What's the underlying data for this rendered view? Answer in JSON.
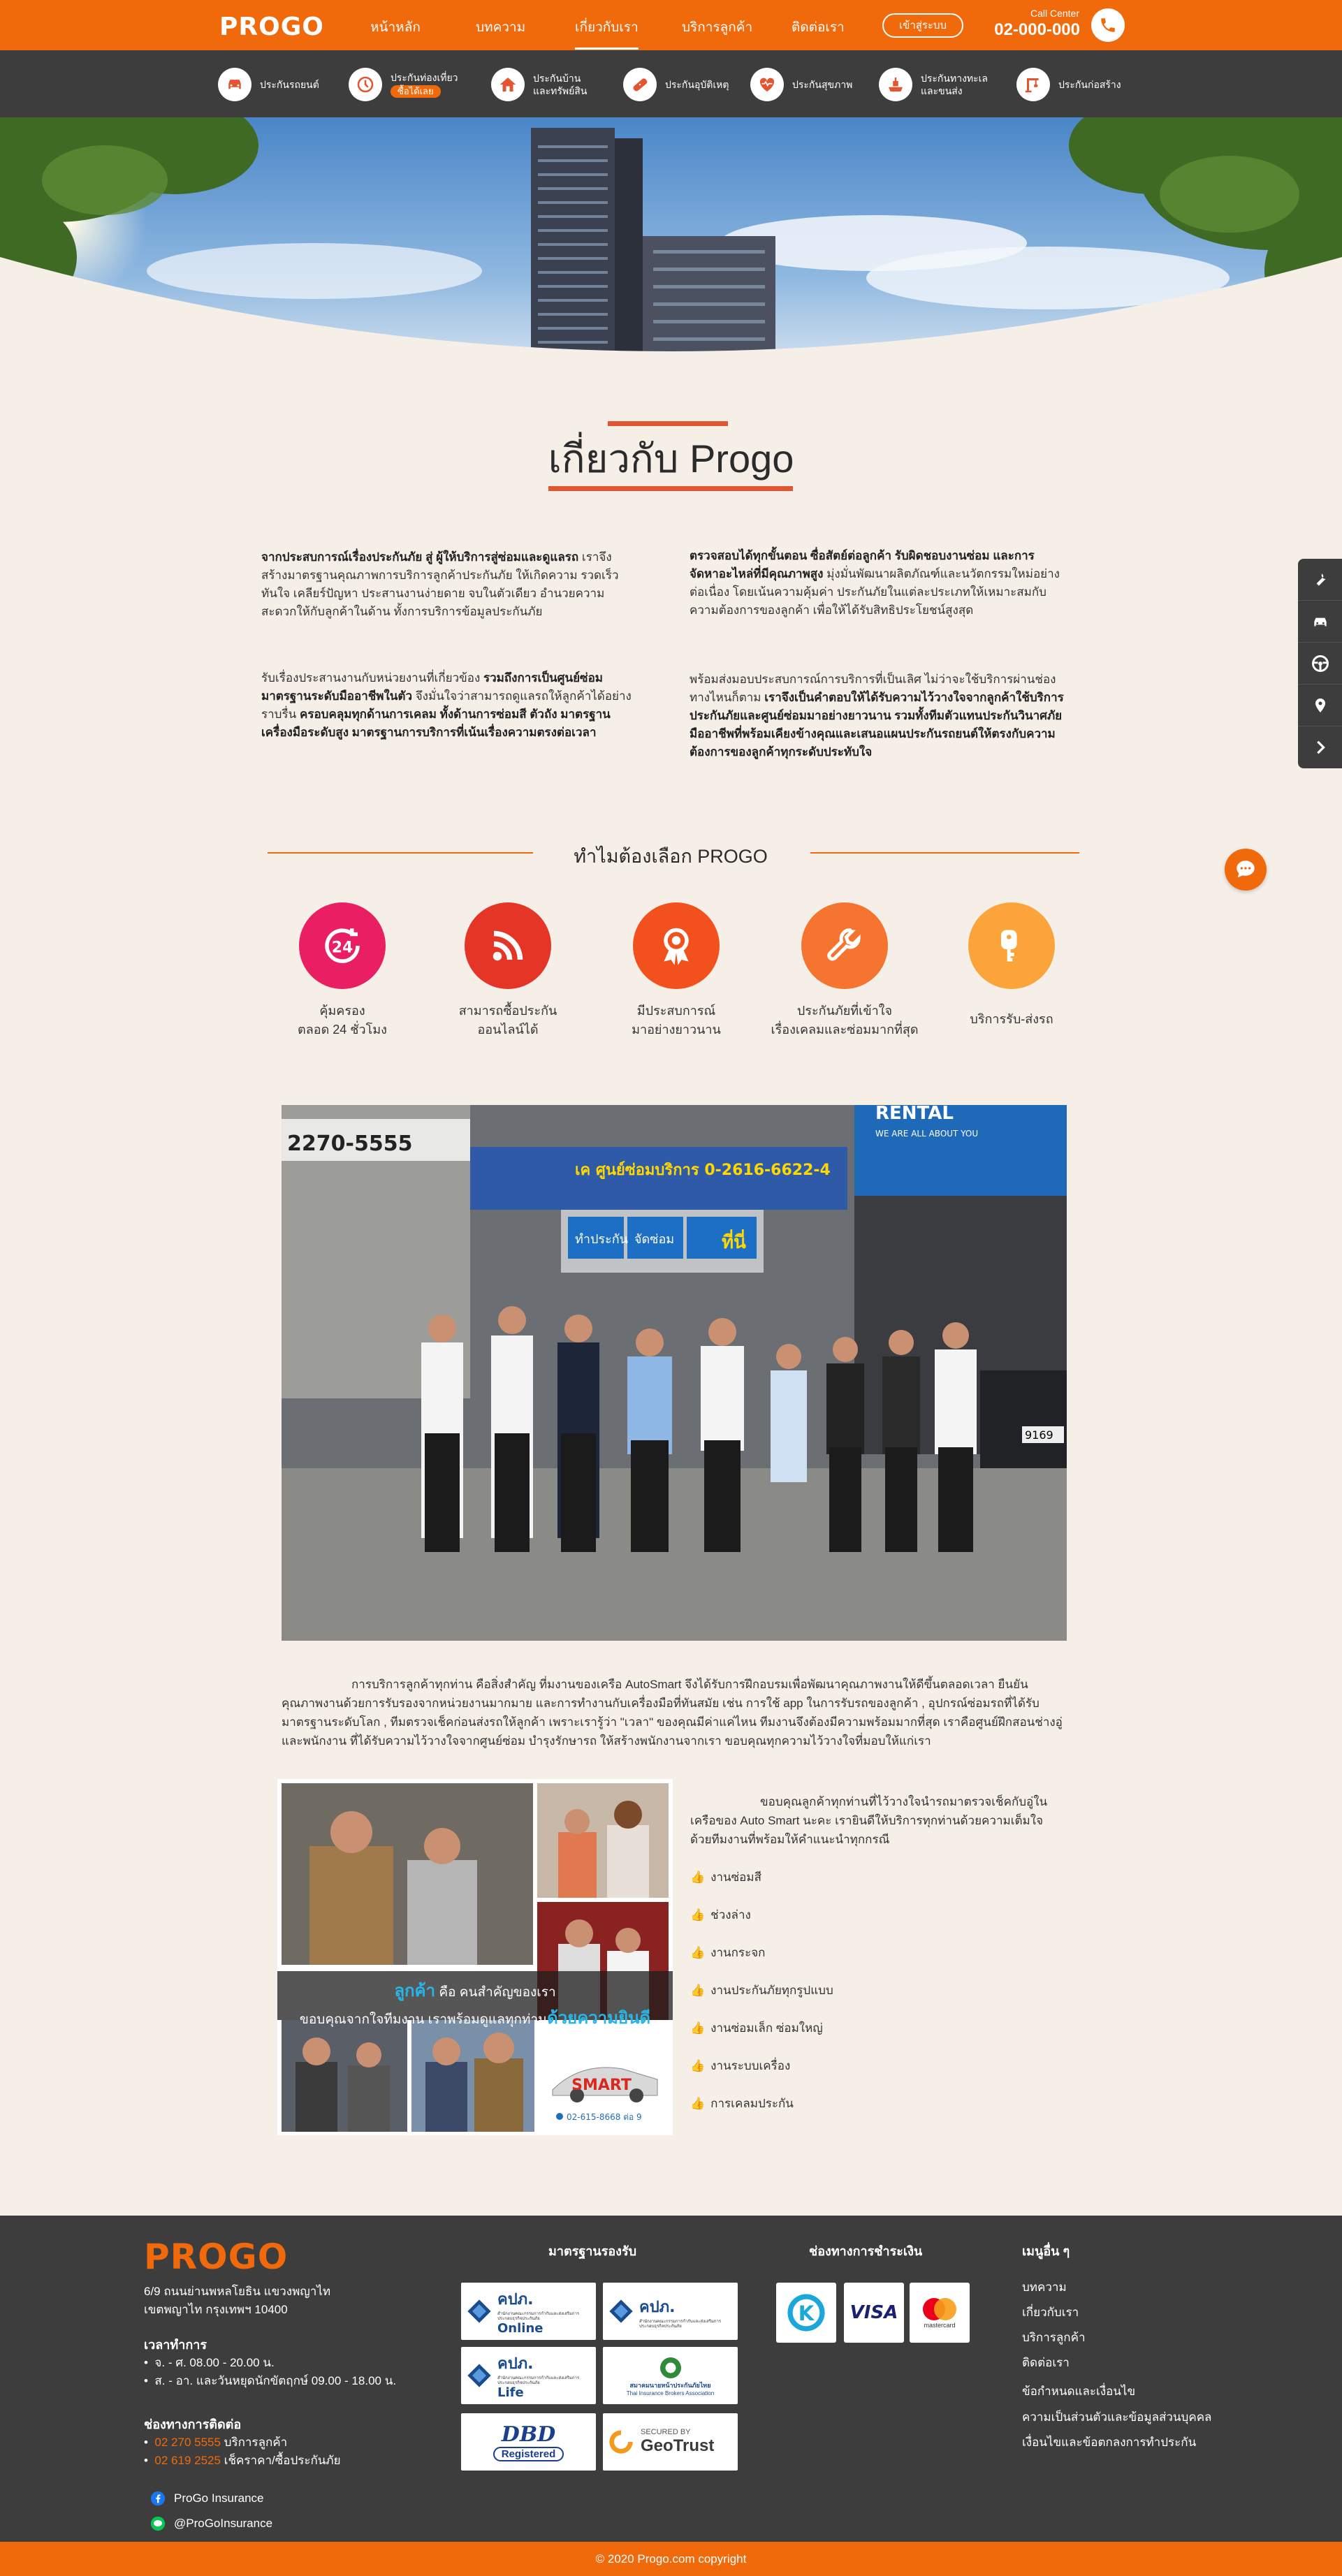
{
  "nav": {
    "logo": "PROGO",
    "items": [
      "หน้าหลัก",
      "บทความ",
      "เกี่ยวกับเรา",
      "บริการลูกค้า",
      "ติดต่อเรา"
    ],
    "login": "เข้าสู่ระบบ",
    "call_label": "Call Center",
    "call_number": "02-000-000"
  },
  "subnav": [
    {
      "label": "ประกันรถยนต์",
      "icon": "car-icon"
    },
    {
      "label": "ประกันท่องเที่ยว",
      "badge": "ซื้อได้เลย",
      "icon": "travel-icon"
    },
    {
      "label": "ประกันบ้าน",
      "label2": "และทรัพย์สิน",
      "icon": "house-icon"
    },
    {
      "label": "ประกันอุบัติเหตุ",
      "icon": "bandage-icon"
    },
    {
      "label": "ประกันสุขภาพ",
      "icon": "heart-pulse-icon"
    },
    {
      "label": "ประกันทางทะเล",
      "label2": "และขนส่ง",
      "icon": "ship-icon"
    },
    {
      "label": "ประกันก่อสร้าง",
      "icon": "crane-icon"
    }
  ],
  "about": {
    "title": "เกี่ยวกับ Progo",
    "p1": {
      "b1": "จากประสบการณ์เรื่องประกันภัย สู่ ผู้ให้บริการสู่ซ่อมและดูแลรถ",
      "t1": " เราจึงสร้างมาตรฐานคุณภาพการบริการลูกค้าประกันภัย ให้เกิดความ รวดเร็ว ทันใจ เคลียร์ปัญหา ประสานงานง่ายดาย จบในตัวเดียว อำนวยความสะดวกให้กับลูกค้าในด้าน ทั้งการบริการข้อมูลประกันภัย"
    },
    "p2": {
      "b1": "ตรวจสอบได้ทุกขั้นตอน ซื่อสัตย์ต่อลูกค้า รับผิดชอบงานซ่อม และการจัดหาอะไหล่ที่มีคุณภาพสูง",
      "t1": " มุ่งมั่นพัฒนาผลิตภัณฑ์และนวัตกรรมใหม่อย่างต่อเนื่อง โดยเน้นความคุ้มค่า ประกันภัยในแต่ละประเภทให้เหมาะสมกับความต้องการของลูกค้า เพื่อให้ได้รับสิทธิประโยชน์สูงสุด"
    },
    "p3": {
      "t1": "รับเรื่องประสานงานกับหน่วยงานที่เกี่ยวข้อง ",
      "b1": "รวมถึงการเป็นศูนย์ซ่อมมาตรฐานระดับมืออาชีพในตัว",
      "t2": " จึงมั่นใจว่าสามารถดูแลรถให้ลูกค้าได้อย่างราบรื่น ",
      "b2": "ครอบคลุมทุกด้านการเคลม ทั้งด้านการซ่อมสี ตัวถัง มาตรฐานเครื่องมือระดับสูง มาตรฐานการบริการที่เน้นเรื่องความตรงต่อเวลา"
    },
    "p4": {
      "t1": "พร้อมส่งมอบประสบการณ์การบริการที่เป็นเลิศ ไม่ว่าจะใช้บริการผ่านช่องทางไหนก็ตาม ",
      "b1": "เราจึงเป็นคำตอบให้ได้รับความไว้วางใจจากลูกค้าใช้บริการประกันภัยและศูนย์ซ่อมมาอย่างยาวนาน รวมทั้งทีมตัวแทนประกันวินาศภัยมืออาชีพที่พร้อมเคียงข้างคุณและเสนอแผนประกันรถยนต์ให้ตรงกับความต้องการของลูกค้าทุกระดับประทับใจ"
    }
  },
  "why": {
    "title": "ทำไมต้องเลือก PROGO",
    "features": [
      {
        "l1": "คุ้มครอง",
        "l2": "ตลอด 24 ชั่วโมง",
        "color": "#e91e63",
        "icon": "clock-24-icon"
      },
      {
        "l1": "สามารถซื้อประกัน",
        "l2": "ออนไลน์ได้",
        "color": "#e53527",
        "icon": "rss-icon"
      },
      {
        "l1": "มีประสบการณ์",
        "l2": "มาอย่างยาวนาน",
        "color": "#f2511d",
        "icon": "award-icon"
      },
      {
        "l1": "ประกันภัยที่เข้าใจ",
        "l2": "เรื่องเคลมและซ่อมมากที่สุด",
        "color": "#f47430",
        "icon": "wrench-icon"
      },
      {
        "l1": "บริการรับ-ส่งรถ",
        "l2": "",
        "color": "#fba43a",
        "icon": "car-key-icon"
      }
    ]
  },
  "photo_signs": {
    "phone": "2270-5555",
    "rental": "RENTAL",
    "rental_sub": "WE ARE ALL ABOUT YOU",
    "banner": "เค ศูนย์ซ่อมบริการ 0-2616-6622-4",
    "s1": "ทำประกัน",
    "s2": "จัดซ่อม",
    "s3": "ที่นี่",
    "plate": "9169"
  },
  "body_text": "การบริการลูกค้าทุกท่าน คือสิ่งสำคัญ ที่มงานของเครือ AutoSmart จึงได้รับการฝึกอบรมเพื่อพัฒนาคุณภาพงานให้ดีขึ้นตลอดเวลา ยืนยันคุณภาพงานด้วยการรับรองจากหน่วยงานมากมาย และการทำงานกับเครื่องมือที่ทันสมัย เช่น การใช้ app ในการรับรถของลูกค้า , อุปกรณ์ซ่อมรถที่ได้รับมาตรฐานระดับโลก , ทีมตรวจเช็คก่อนส่งรถให้ลูกค้า เพราะเรารู้ว่า \"เวลา\" ของคุณมีค่าแค่ไหน ทีมงานจึงต้องมีความพร้อมมากที่สุด  เราคือศูนย์ฝึกสอนช่างอู่และพนักงาน ที่ได้รับความไว้วางใจจากศูนย์ซ่อม บำรุงรักษารถ ให้สร้างพนักงานจากเรา ขอบคุณทุกความไว้วางใจที่มอบให้แก่เรา",
  "collage": {
    "caption_accent1": "ลูกค้า",
    "caption1": " คือ คนสำคัญของเรา",
    "caption2": "ขอบคุณจากใจทีมงาน เราพร้อมดูแลทุกท่าน",
    "caption_accent2": "ด้วยความยินดี",
    "brand": "SMART",
    "phone": "02-615-8668 ต่อ 9"
  },
  "thanks": {
    "text": "ขอบคุณลูกค้าทุกท่านที่ไว้วางใจนำรถมาตรวจเช็คกับอู่ในเครือของ Auto Smart นะคะ เรายินดีให้บริการทุกท่านด้วยความเต็มใจ ด้วยทีมงานที่พร้อมให้คำแนะนำทุกกรณี",
    "services": [
      "งานซ่อมสี",
      "ช่วงล่าง",
      "งานกระจก",
      "งานประกันภัยทุกรูปแบบ",
      "งานซ่อมเล็ก ซ่อมใหญ่",
      "งานระบบเครื่อง",
      "การเคลมประกัน"
    ]
  },
  "footer": {
    "logo": "PROGO",
    "addr1": "6/9 ถนนย่านพหลโยธิน แขวงพญาไท",
    "addr2": "เขตพญาไท กรุงเทพฯ 10400",
    "hours_title": "เวลาทำการ",
    "hours": [
      "จ. - ศ. 08.00 - 20.00 น.",
      "ส. - อา. และวันหยุดนักขัตฤกษ์ 09.00 - 18.00 น."
    ],
    "contact_title": "ช่องทางการติดต่อ",
    "contacts": [
      {
        "num": "02 270 5555",
        "label": " บริการลูกค้า"
      },
      {
        "num": "02 619 2525",
        "label": " เช็คราคา/ซื้อประกันภัย"
      }
    ],
    "facebook": "ProGo Insurance",
    "line": "@ProGoInsurance",
    "cert_title": "มาตรฐานรองรับ",
    "certs": [
      {
        "abbr": "คปภ.",
        "small": "สำนักงานคณะกรรมการกำกับและส่งเสริมการประกอบธุรกิจประกันภัย",
        "tag": "Online"
      },
      {
        "abbr": "คปภ.",
        "small": "สำนักงานคณะกรรมการกำกับและส่งเสริมการประกอบธุรกิจประกันภัย",
        "tag": ""
      },
      {
        "abbr": "คปภ.",
        "small": "สำนักงานคณะกรรมการกำกับและส่งเสริมการประกอบธุรกิจประกันภัย",
        "tag": "Life"
      },
      {
        "abbr": "สมาคมนายหน้าประกันภัยไทย",
        "small": "Thai Insurance Brokers Association",
        "tag": ""
      },
      {
        "abbr": "DBD",
        "small": "",
        "tag": "Registered"
      },
      {
        "abbr": "GeoTrust",
        "small": "SECURED BY",
        "tag": ""
      }
    ],
    "pay_title": "ช่องทางการชำระเงิน",
    "pay": [
      "K",
      "VISA",
      "mastercard"
    ],
    "menu_title": "เมนูอื่น ๆ",
    "menu": [
      "บทความ",
      "เกี่ยวกับเรา",
      "บริการลูกค้า",
      "ติดต่อเรา",
      "ข้อกำหนดและเงื่อนไข",
      "ความเป็นส่วนตัวและข้อมูลส่วนบุคคล",
      "เงื่อนไขและข้อตกลงการทำประกัน"
    ],
    "copyright": "© 2020 Progo.com copyright"
  },
  "colors": {
    "brand": "#f06a0c",
    "dark": "#3d3d3d",
    "bg": "#f5efe8",
    "accent_bar": "#e2552e"
  }
}
